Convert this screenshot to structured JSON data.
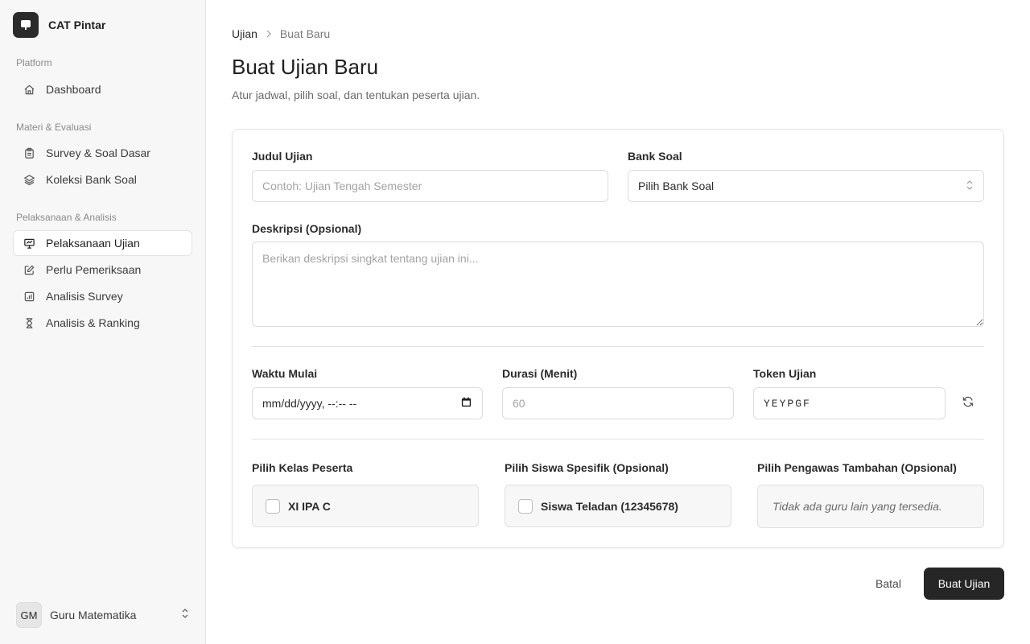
{
  "app": {
    "name": "CAT Pintar"
  },
  "sidebar": {
    "sections": [
      {
        "label": "Platform",
        "items": [
          {
            "label": "Dashboard",
            "icon": "home-icon"
          }
        ]
      },
      {
        "label": "Materi & Evaluasi",
        "items": [
          {
            "label": "Survey & Soal Dasar",
            "icon": "clipboard-icon"
          },
          {
            "label": "Koleksi Bank Soal",
            "icon": "layers-icon"
          }
        ]
      },
      {
        "label": "Pelaksanaan & Analisis",
        "items": [
          {
            "label": "Pelaksanaan Ujian",
            "icon": "presentation-icon",
            "active": true
          },
          {
            "label": "Perlu Pemeriksaan",
            "icon": "edit-icon"
          },
          {
            "label": "Analisis Survey",
            "icon": "bar-chart-icon"
          },
          {
            "label": "Analisis & Ranking",
            "icon": "hourglass-icon"
          }
        ]
      }
    ],
    "user": {
      "initials": "GM",
      "name": "Guru Matematika"
    }
  },
  "breadcrumb": {
    "parent": "Ujian",
    "current": "Buat Baru"
  },
  "page": {
    "title": "Buat Ujian Baru",
    "subtitle": "Atur jadwal, pilih soal, dan tentukan peserta ujian."
  },
  "form": {
    "judul": {
      "label": "Judul Ujian",
      "placeholder": "Contoh: Ujian Tengah Semester",
      "value": ""
    },
    "bank_soal": {
      "label": "Bank Soal",
      "selected": "Pilih Bank Soal"
    },
    "deskripsi": {
      "label": "Deskripsi (Opsional)",
      "placeholder": "Berikan deskripsi singkat tentang ujian ini..."
    },
    "waktu_mulai": {
      "label": "Waktu Mulai",
      "placeholder": "mm/dd/yyyy, --:-- --"
    },
    "durasi": {
      "label": "Durasi (Menit)",
      "placeholder": "60"
    },
    "token": {
      "label": "Token Ujian",
      "value": "YEYPGF"
    },
    "kelas": {
      "label": "Pilih Kelas Peserta",
      "options": [
        {
          "label": "XI IPA C",
          "checked": false
        }
      ]
    },
    "siswa": {
      "label": "Pilih Siswa Spesifik (Opsional)",
      "options": [
        {
          "label": "Siswa Teladan (12345678)",
          "checked": false
        }
      ]
    },
    "pengawas": {
      "label": "Pilih Pengawas Tambahan (Opsional)",
      "empty": "Tidak ada guru lain yang tersedia."
    }
  },
  "actions": {
    "cancel": "Batal",
    "submit": "Buat Ujian"
  }
}
